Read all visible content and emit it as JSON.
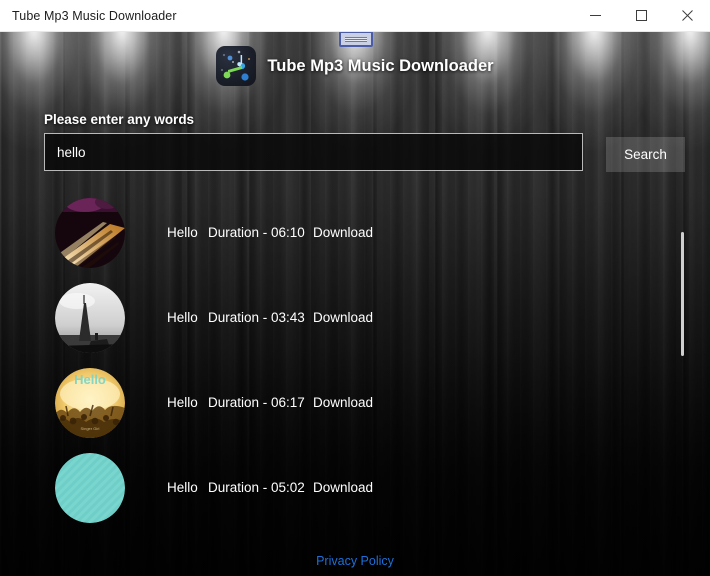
{
  "window": {
    "title": "Tube Mp3 Music Downloader",
    "controls": {
      "minimize": "minimize-icon",
      "maximize": "maximize-icon",
      "close": "close-icon"
    }
  },
  "header": {
    "logo_icon": "music-app-logo-icon",
    "app_title": "Tube Mp3 Music Downloader"
  },
  "drag_widget": {
    "name": "window-drag-handle"
  },
  "search": {
    "label": "Please enter any words",
    "value": "hello",
    "placeholder": "",
    "button_label": "Search"
  },
  "results": [
    {
      "thumbnail": "piano-keys-thumbnail",
      "title": "Hello",
      "duration": "Duration - 06:10",
      "download_label": "Download"
    },
    {
      "thumbnail": "eiffel-tower-thumbnail",
      "title": "Hello",
      "duration": "Duration - 03:43",
      "download_label": "Download"
    },
    {
      "thumbnail": "concert-crowd-thumbnail",
      "title": "Hello",
      "duration": "Duration - 06:17",
      "download_label": "Download"
    },
    {
      "thumbnail": "teal-circle-thumbnail",
      "title": "Hello",
      "duration": "Duration - 05:02",
      "download_label": "Download"
    }
  ],
  "scrollbar": {
    "name": "results-scrollbar"
  },
  "footer": {
    "privacy_label": "Privacy Policy"
  },
  "colors": {
    "link": "#1e6fd9",
    "text": "#ffffff",
    "background": "#262626",
    "button": "rgba(255,255,255,0.17)",
    "teal_thumb": "#6fcfc8"
  }
}
